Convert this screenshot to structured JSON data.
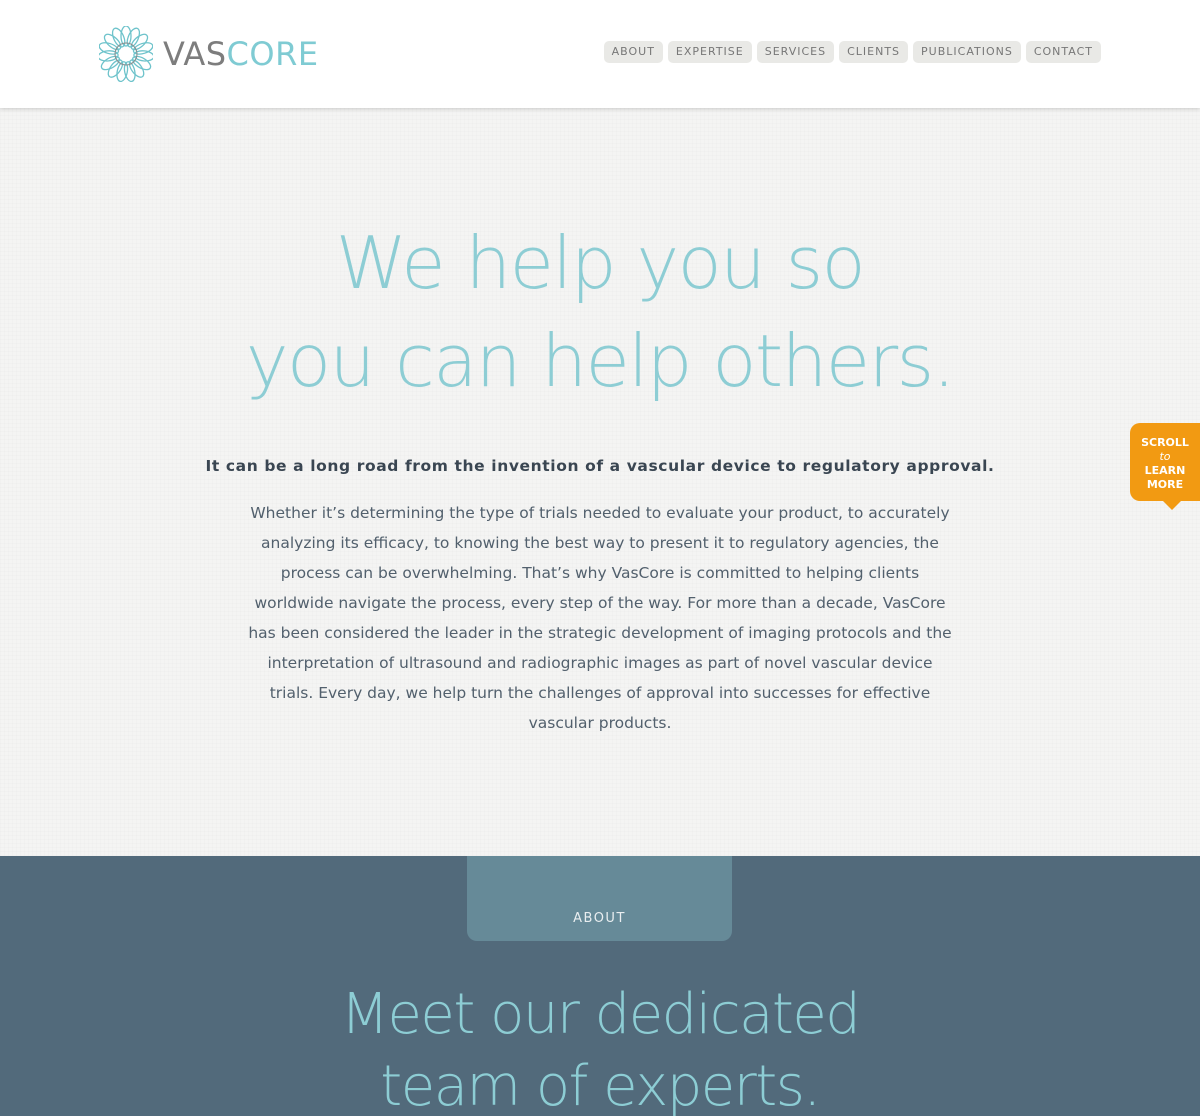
{
  "brand": {
    "part1": "VAS",
    "part2": "CORE",
    "colors": {
      "gray": "#7d7d7d",
      "teal": "#7fcbd3",
      "orange": "#f29a12",
      "slate": "#526a7b"
    }
  },
  "nav": {
    "items": [
      "ABOUT",
      "EXPERTISE",
      "SERVICES",
      "CLIENTS",
      "PUBLICATIONS",
      "CONTACT"
    ]
  },
  "hero": {
    "headline_line1": "We help you so",
    "headline_line2": "you can help others.",
    "lede": "It can be a long road from the invention of a vascular device to regulatory approval.",
    "body": "Whether it’s determining the type of trials needed to evaluate your product, to accurately analyzing its efficacy, to knowing the best way to present it to regulatory agencies, the process can be overwhelming. That’s why VasCore is committed to helping clients worldwide navigate the process, every step of the way. For more than a decade, VasCore has been considered the leader in the strategic development of imaging protocols and the interpretation of ultrasound and radiographic images as part of novel vascular device trials. Every day, we help turn the challenges of approval into successes for effective vascular products."
  },
  "scroll_tab": {
    "line1": "SCROLL",
    "line2": "to",
    "line3": "LEARN",
    "line4": "MORE",
    "icon": "arrow-down-icon"
  },
  "about": {
    "tab_label": "ABOUT",
    "title_line1": "Meet our dedicated",
    "title_line2": "team of experts."
  }
}
